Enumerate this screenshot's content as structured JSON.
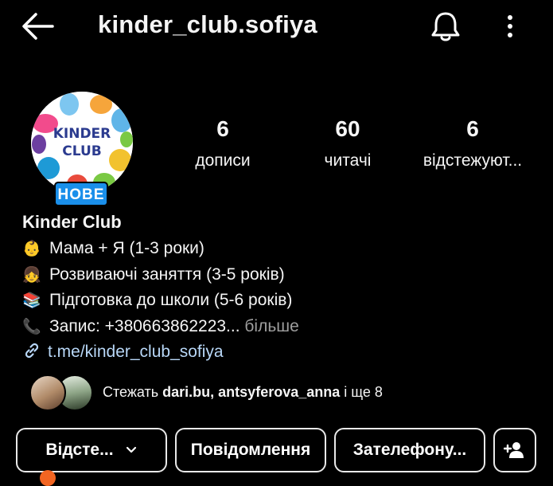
{
  "header": {
    "username": "kinder_club.sofiya"
  },
  "profile": {
    "avatar_text_line1": "KINDER",
    "avatar_text_line2": "CLUB",
    "badge": "НОВЕ",
    "stats": [
      {
        "value": "6",
        "label": "дописи"
      },
      {
        "value": "60",
        "label": "читачі"
      },
      {
        "value": "6",
        "label": "відстежуют..."
      }
    ]
  },
  "bio": {
    "name": "Kinder Club",
    "lines": [
      {
        "emoji": "👶",
        "text": "Мама + Я (1-3 роки)"
      },
      {
        "emoji": "👧",
        "text": "Розвиваючі заняття (3-5 років)"
      },
      {
        "emoji": "📚",
        "text": "Підготовка до школи (5-6 років)"
      },
      {
        "emoji": "📞",
        "text": "Запис: +380663862223..."
      }
    ],
    "more": " більше",
    "link": "t.me/kinder_club_sofiya"
  },
  "followed_by": {
    "prefix": "Стежать ",
    "user1": "dari.bu",
    "sep": ", ",
    "user2": "antsyferova_anna",
    "suffix": " і ще 8"
  },
  "actions": {
    "follow": "Відсте...",
    "message": "Повідомлення",
    "call": "Зателефону..."
  },
  "colors": {
    "background": "#000000",
    "badge": "#1a8fea",
    "link": "#b8d7f7"
  }
}
